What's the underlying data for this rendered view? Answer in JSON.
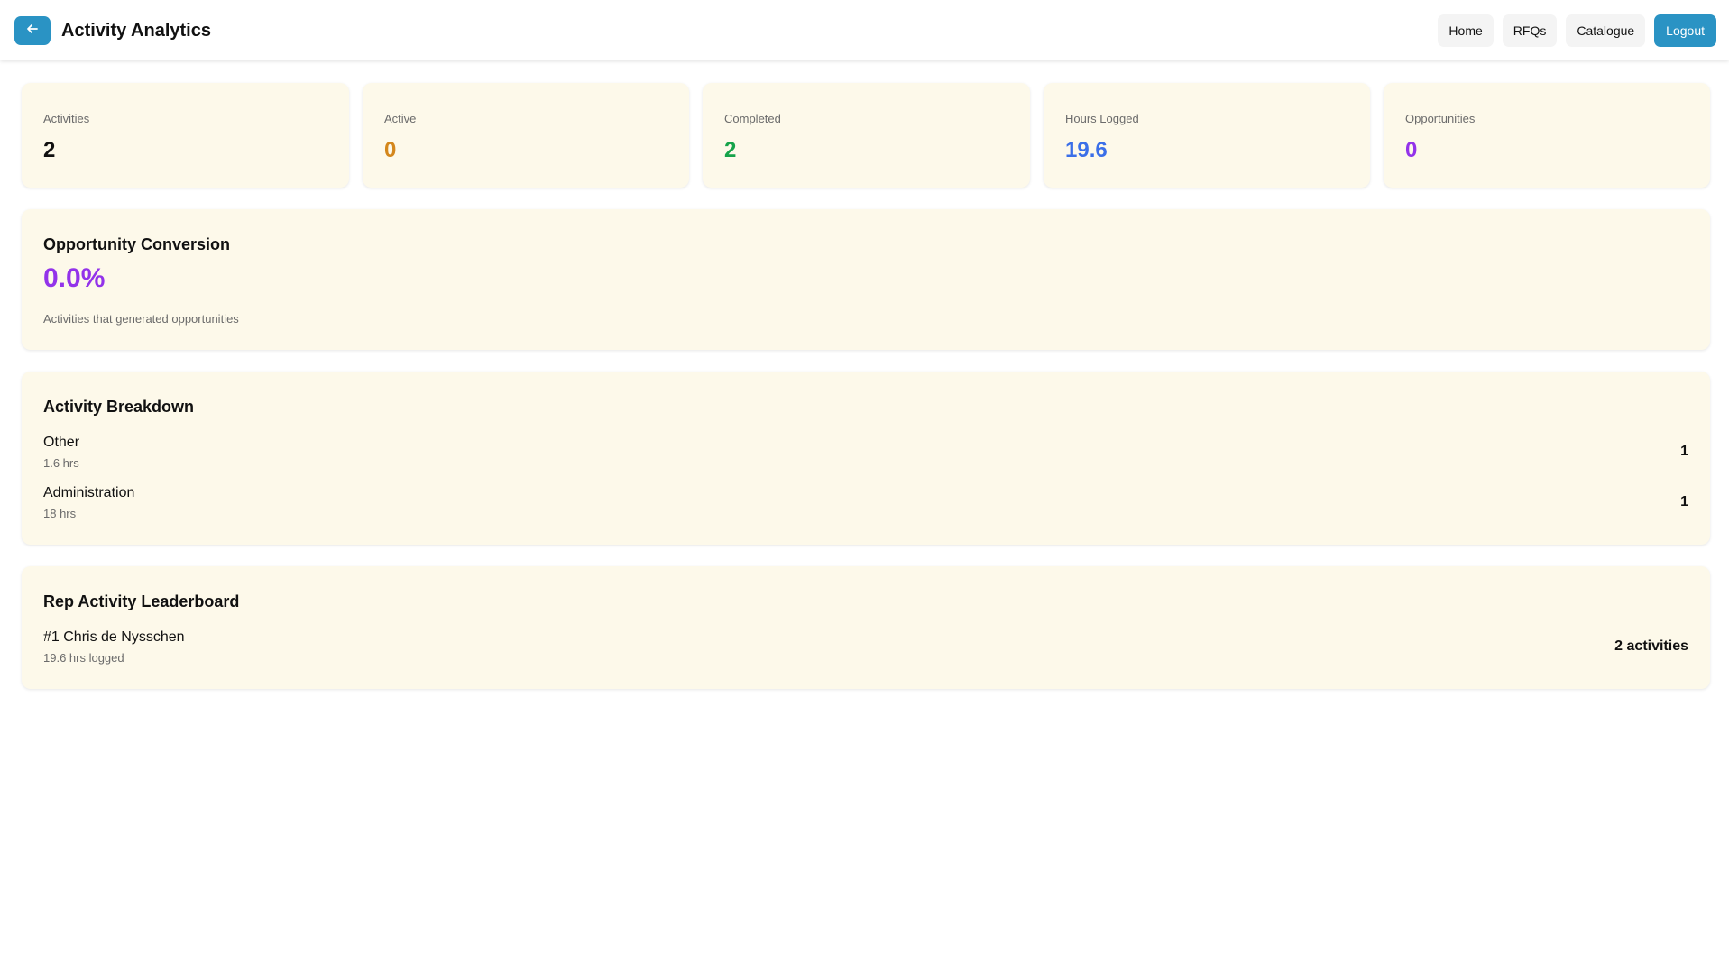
{
  "header": {
    "title": "Activity Analytics",
    "back_icon": "arrow-left-icon",
    "nav": {
      "home": "Home",
      "rfqs": "RFQs",
      "catalogue": "Catalogue",
      "logout": "Logout"
    }
  },
  "stats": [
    {
      "label": "Activities",
      "value": "2",
      "color": "#111111"
    },
    {
      "label": "Active",
      "value": "0",
      "color": "#d4871c"
    },
    {
      "label": "Completed",
      "value": "2",
      "color": "#16a34a"
    },
    {
      "label": "Hours Logged",
      "value": "19.6",
      "color": "#3b6fe8"
    },
    {
      "label": "Opportunities",
      "value": "0",
      "color": "#9333ea"
    }
  ],
  "conversion": {
    "title": "Opportunity Conversion",
    "value": "0.0%",
    "caption": "Activities that generated opportunities",
    "color": "#9333ea"
  },
  "breakdown": {
    "title": "Activity Breakdown",
    "items": [
      {
        "name": "Other",
        "hours": "1.6 hrs",
        "count": "1"
      },
      {
        "name": "Administration",
        "hours": "18 hrs",
        "count": "1"
      }
    ]
  },
  "leaderboard": {
    "title": "Rep Activity Leaderboard",
    "items": [
      {
        "name": "#1 Chris de Nysschen",
        "hours": "19.6 hrs logged",
        "count": "2 activities"
      }
    ]
  },
  "colors": {
    "accent": "#2a93c4",
    "card_bg": "#fdf9ea"
  }
}
